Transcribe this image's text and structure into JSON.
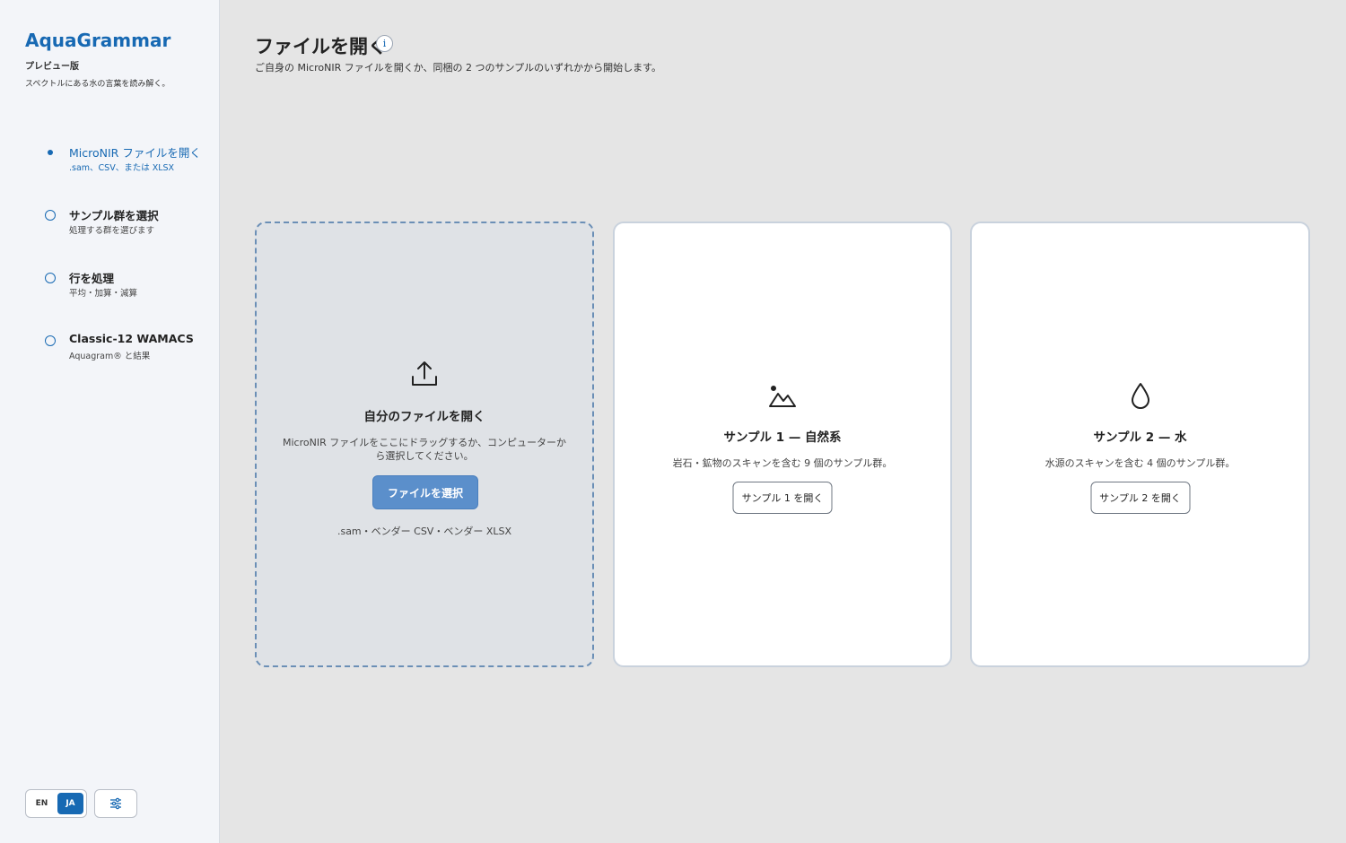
{
  "sidebar": {
    "brand": "AquaGrammar",
    "edition": "プレビュー版",
    "tagline": "スペクトルにある水の言葉を読み解く。",
    "steps": [
      {
        "title": "MicroNIR ファイルを開く",
        "subtitle": ".sam、CSV、または XLSX",
        "state": "active"
      },
      {
        "title": "サンプル群を選択",
        "subtitle": "処理する群を選びます",
        "state": "pending"
      },
      {
        "title": "行を処理",
        "subtitle": "平均・加算・減算",
        "state": "pending"
      },
      {
        "title": "Classic-12 WAMACS",
        "subtitle": "Aquagram® と結果",
        "state": "pending"
      }
    ],
    "language": {
      "options": [
        "EN",
        "JA"
      ],
      "selected": "JA"
    },
    "settings_icon": "sliders-icon"
  },
  "header": {
    "title": "ファイルを開く",
    "info_icon_glyph": "i",
    "subtitle": "ご自身の MicroNIR ファイルを開くか、同梱の 2 つのサンプルのいずれかから開始します。"
  },
  "cards": {
    "upload": {
      "icon": "upload-icon",
      "title": "自分のファイルを開く",
      "description": "MicroNIR ファイルをここにドラッグするか、コンピューターから選択してください。",
      "button": "ファイルを選択",
      "formats": ".sam・ベンダー CSV・ベンダー XLSX"
    },
    "sample1": {
      "icon": "mountain-icon",
      "title": "サンプル 1 — 自然系",
      "description": "岩石・鉱物のスキャンを含む 9 個のサンプル群。",
      "button": "サンプル 1 を開く"
    },
    "sample2": {
      "icon": "water-drop-icon",
      "title": "サンプル 2 — 水",
      "description": "水源のスキャンを含む 4 個のサンプル群。",
      "button": "サンプル 2 を開く"
    }
  },
  "colors": {
    "accent": "#1769b3",
    "primary_button": "#5b8fcb",
    "page_background": "#e5e5e5",
    "sidebar_background": "#f3f5f9"
  }
}
